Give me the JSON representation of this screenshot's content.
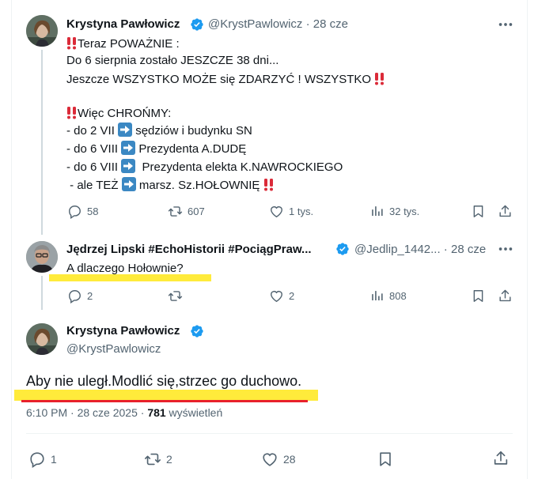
{
  "tweet1": {
    "author": "Krystyna Pawłowicz",
    "handle": "@KrystPawlowicz",
    "time_prefix": " · ",
    "time": "28 cze",
    "line1_rest": "Teraz POWAŻNIE :",
    "line2": "Do 6 sierpnia zostało JESZCZE 38 dni...",
    "line3": "Jeszcze WSZYSTKO MOŻE się ZDARZYĆ ! WSZYSTKO ",
    "line5_rest": "Więc CHROŃMY:",
    "item1_pre": "- do 2 VII ",
    "item1_post": " sędziów i budynku SN",
    "item2_pre": "- do 6 VIII ",
    "item2_post": " Prezydenta A.DUDĘ",
    "item3_pre": "- do 6 VIII ",
    "item3_post": "  Prezydenta elekta K.NAWROCKIEGO",
    "item4_pre": " - ale TEŻ ",
    "item4_post": " marsz. Sz.HOŁOWNIĘ ",
    "replies": "58",
    "reposts": "607",
    "likes": "1 tys.",
    "views": "32 tys."
  },
  "tweet2": {
    "author": "Jędrzej Lipski #EchoHistorii #PociągPraw...",
    "handle": "@Jedlip_1442...",
    "time_prefix": " · ",
    "time": "28 cze",
    "text": "A dlaczego Hołownie?",
    "replies": "2",
    "likes": "2",
    "views": "808"
  },
  "tweet3": {
    "author": "Krystyna Pawłowicz",
    "handle": "@KrystPawlowicz",
    "text": "Aby nie uległ.Modlić się,strzec go duchowo.",
    "timestamp": "6:10 PM · 28 cze 2025 · ",
    "views_count": "781",
    "views_label": " wyświetleń",
    "replies": "1",
    "reposts": "2",
    "likes": "28"
  },
  "colors": {
    "verified": "#1d9bf0",
    "text_secondary": "#536471",
    "highlight": "#ffeb3b",
    "underline": "#e8212b",
    "emoji_red": "#db2b39",
    "arrow_blue": "#3b88c3"
  },
  "icons": [
    "verified-badge-icon",
    "more-icon",
    "reply-icon",
    "repost-icon",
    "like-icon",
    "views-icon",
    "bookmark-icon",
    "share-icon",
    "double-exclamation-icon",
    "right-arrow-icon"
  ]
}
